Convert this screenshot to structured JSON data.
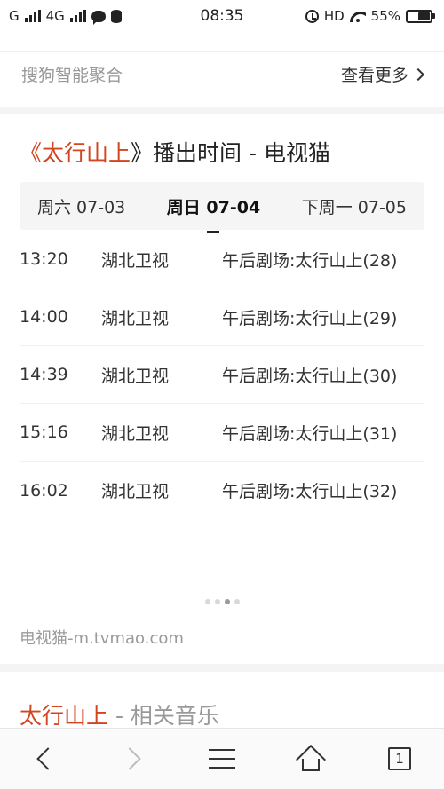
{
  "status_bar": {
    "signal1_label": "G",
    "signal2_label": "4G",
    "time": "08:35",
    "hd_label": "HD",
    "battery_text": "55%",
    "battery_level": 0.55
  },
  "sogou": {
    "label": "搜狗智能聚合",
    "more_label": "查看更多"
  },
  "card": {
    "title_open": "《",
    "title_name": "太行山上",
    "title_close": "》",
    "title_rest": "播出时间 - 电视猫"
  },
  "tabs": [
    {
      "label": "周六 07-03",
      "active": false
    },
    {
      "label": "周日 07-04",
      "active": true
    },
    {
      "label": "下周一 07-05",
      "active": false
    }
  ],
  "schedule": [
    {
      "time": "13:20",
      "channel": "湖北卫视",
      "program": "午后剧场:太行山上(28)"
    },
    {
      "time": "14:00",
      "channel": "湖北卫视",
      "program": "午后剧场:太行山上(29)"
    },
    {
      "time": "14:39",
      "channel": "湖北卫视",
      "program": "午后剧场:太行山上(30)"
    },
    {
      "time": "15:16",
      "channel": "湖北卫视",
      "program": "午后剧场:太行山上(31)"
    },
    {
      "time": "16:02",
      "channel": "湖北卫视",
      "program": "午后剧场:太行山上(32)"
    }
  ],
  "pager": {
    "count": 4,
    "active_index": 2
  },
  "source": "电视猫-m.tvmao.com",
  "related": {
    "name": "太行山上",
    "rest": " - 相关音乐"
  },
  "navbar": {
    "tab_count": "1"
  },
  "colors": {
    "accent": "#d3451f",
    "muted_text": "#999999",
    "tab_background": "#f5f5f5"
  }
}
